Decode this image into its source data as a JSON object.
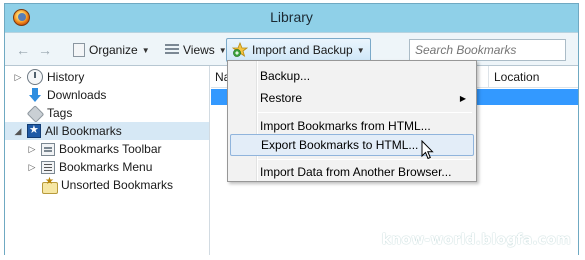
{
  "window": {
    "title": "Library"
  },
  "toolbar": {
    "organize_label": "Organize",
    "views_label": "Views",
    "import_backup_label": "Import and Backup",
    "search_placeholder": "Search Bookmarks"
  },
  "sidebar": {
    "items": [
      {
        "label": "History",
        "icon": "history-icon",
        "twisty": "collapsed"
      },
      {
        "label": "Downloads",
        "icon": "download-icon",
        "twisty": "none"
      },
      {
        "label": "Tags",
        "icon": "tag-icon",
        "twisty": "none"
      },
      {
        "label": "All Bookmarks",
        "icon": "bookmarks-star-icon",
        "twisty": "expanded",
        "selected": true
      },
      {
        "label": "Bookmarks Toolbar",
        "icon": "toolbar-folder-icon",
        "twisty": "collapsed"
      },
      {
        "label": "Bookmarks Menu",
        "icon": "menu-folder-icon",
        "twisty": "collapsed"
      },
      {
        "label": "Unsorted Bookmarks",
        "icon": "unsorted-folder-icon",
        "twisty": "none"
      }
    ]
  },
  "list": {
    "columns": [
      "Na",
      "Location"
    ]
  },
  "import_menu": {
    "items": [
      {
        "label": "Backup..."
      },
      {
        "label": "Restore",
        "has_submenu": true
      },
      {
        "label": "Import Bookmarks from HTML..."
      },
      {
        "label": "Export Bookmarks to HTML...",
        "hovered": true
      },
      {
        "label": "Import Data from Another Browser..."
      }
    ]
  },
  "watermark": "know-world.blogfa.com",
  "colors": {
    "window_frame": "#8fd0e8",
    "selection": "#3399ff",
    "menu_hover": "#e3edf8"
  }
}
